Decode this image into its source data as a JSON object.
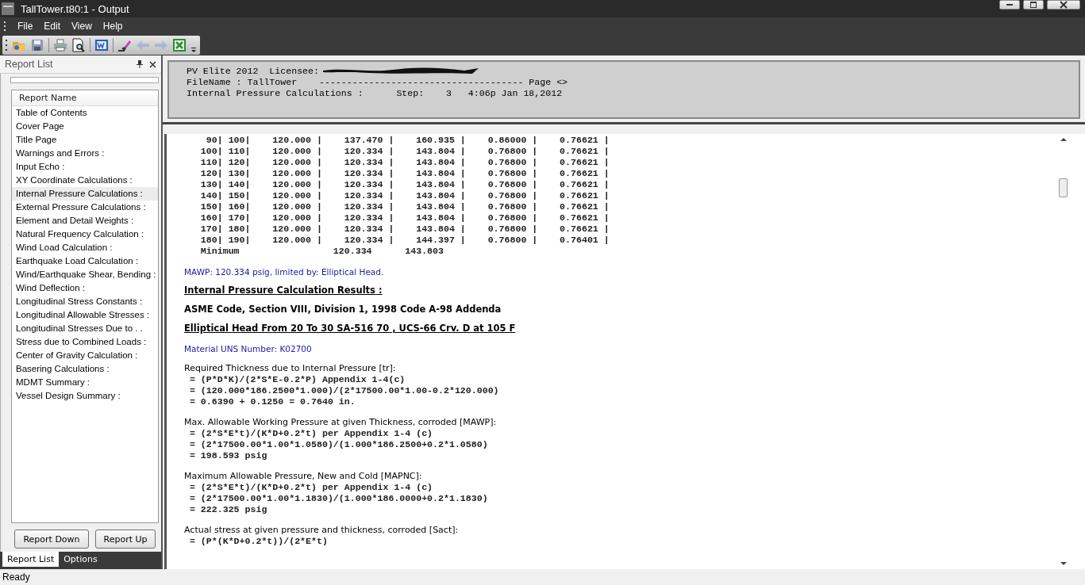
{
  "window": {
    "title": "TallTower.t80:1 - Output"
  },
  "menu": [
    "File",
    "Edit",
    "View",
    "Help"
  ],
  "toolbar": [
    {
      "kind": "open",
      "disabled": false
    },
    {
      "kind": "save",
      "disabled": false
    },
    {
      "kind": "sep"
    },
    {
      "kind": "print",
      "disabled": false
    },
    {
      "kind": "preview",
      "disabled": false
    },
    {
      "kind": "sep"
    },
    {
      "kind": "word",
      "disabled": false
    },
    {
      "kind": "sep"
    },
    {
      "kind": "eraser",
      "disabled": false
    },
    {
      "kind": "back",
      "disabled": true
    },
    {
      "kind": "forward",
      "disabled": true
    },
    {
      "kind": "excel",
      "disabled": false
    }
  ],
  "report_list": {
    "title": "Report List",
    "column": "Report Name",
    "items": [
      {
        "label": "Table of Contents",
        "selected": false
      },
      {
        "label": "Cover Page",
        "selected": false
      },
      {
        "label": "Title Page",
        "selected": false
      },
      {
        "label": "Warnings and Errors :",
        "selected": false
      },
      {
        "label": "Input Echo :",
        "selected": false
      },
      {
        "label": "XY Coordinate Calculations :",
        "selected": false
      },
      {
        "label": "Internal Pressure Calculations :",
        "selected": true
      },
      {
        "label": "External Pressure Calculations :",
        "selected": false
      },
      {
        "label": "Element and Detail Weights :",
        "selected": false
      },
      {
        "label": "Natural Frequency Calculation :",
        "selected": false
      },
      {
        "label": "Wind Load Calculation :",
        "selected": false
      },
      {
        "label": "Earthquake Load Calculation :",
        "selected": false
      },
      {
        "label": "Wind/Earthquake Shear, Bending :",
        "selected": false
      },
      {
        "label": "Wind Deflection :",
        "selected": false
      },
      {
        "label": "Longitudinal Stress Constants :",
        "selected": false
      },
      {
        "label": "Longitudinal Allowable Stresses :",
        "selected": false
      },
      {
        "label": "Longitudinal Stresses Due to . .",
        "selected": false
      },
      {
        "label": "Stress due to Combined Loads :",
        "selected": false
      },
      {
        "label": "Center of Gravity Calculation :",
        "selected": false
      },
      {
        "label": "Basering Calculations :",
        "selected": false
      },
      {
        "label": "MDMT Summary :",
        "selected": false
      },
      {
        "label": "Vessel Design Summary :",
        "selected": false
      }
    ],
    "buttons": [
      "Report Down",
      "Report Up"
    ]
  },
  "panel_tabs": [
    {
      "label": "Report List",
      "selected": true
    },
    {
      "label": "Options",
      "selected": false
    }
  ],
  "header": {
    "lines": [
      {
        "text": "PV Elite 2012  Licensee: ",
        "redacted": true
      },
      {
        "text": "FileName : TallTower    ------------------------------------- Page <>",
        "redacted": false
      },
      {
        "text": "Internal Pressure Calculations :      Step:    3   4:06p Jan 18,2012",
        "redacted": false
      }
    ]
  },
  "report": [
    {
      "kind": "mono",
      "text": "    90| 100|    120.000 |    137.470 |    160.935 |    0.86000 |    0.76621 |"
    },
    {
      "kind": "mono",
      "text": "   100| 110|    120.000 |    120.334 |    143.804 |    0.76800 |    0.76621 |"
    },
    {
      "kind": "mono",
      "text": "   110| 120|    120.000 |    120.334 |    143.804 |    0.76800 |    0.76621 |"
    },
    {
      "kind": "mono",
      "text": "   120| 130|    120.000 |    120.334 |    143.804 |    0.76800 |    0.76621 |"
    },
    {
      "kind": "mono",
      "text": "   130| 140|    120.000 |    120.334 |    143.804 |    0.76800 |    0.76621 |"
    },
    {
      "kind": "mono",
      "text": "   140| 150|    120.000 |    120.334 |    143.804 |    0.76800 |    0.76621 |"
    },
    {
      "kind": "mono",
      "text": "   150| 160|    120.000 |    120.334 |    143.804 |    0.76800 |    0.76621 |"
    },
    {
      "kind": "mono",
      "text": "   160| 170|    120.000 |    120.334 |    143.804 |    0.76800 |    0.76621 |"
    },
    {
      "kind": "mono",
      "text": "   170| 180|    120.000 |    120.334 |    143.804 |    0.76800 |    0.76621 |"
    },
    {
      "kind": "mono",
      "text": "   180| 190|    120.000 |    120.334 |    144.397 |    0.76800 |    0.76401 |"
    },
    {
      "kind": "mono",
      "text": "   Minimum                 120.334      143.803"
    },
    {
      "kind": "note",
      "text": "MAWP: 120.334 psig, limited by: Elliptical Head."
    },
    {
      "kind": "heading",
      "text": "Internal Pressure Calculation Results :"
    },
    {
      "kind": "bold",
      "text": "ASME Code, Section VIII, Division 1, 1998 Code A-98 Addenda"
    },
    {
      "kind": "heading",
      "text": "Elliptical Head From 20 To 30 SA-516 70 , UCS-66 Crv. D at 105 F"
    },
    {
      "kind": "note",
      "text": "Material UNS Number:    K02700"
    },
    {
      "kind": "label",
      "text": "Required Thickness due to Internal Pressure [tr]:"
    },
    {
      "kind": "mono",
      "text": " = (P*D*K)/(2*S*E-0.2*P) Appendix 1-4(c)"
    },
    {
      "kind": "mono",
      "text": " = (120.000*186.2500*1.000)/(2*17500.00*1.00-0.2*120.000)"
    },
    {
      "kind": "mono",
      "text": " = 0.6390 + 0.1250 = 0.7640 in."
    },
    {
      "kind": "label",
      "text": "Max. Allowable Working Pressure at given Thickness, corroded [MAWP]:"
    },
    {
      "kind": "mono",
      "text": " = (2*S*E*t)/(K*D+0.2*t) per Appendix 1-4 (c)"
    },
    {
      "kind": "mono",
      "text": " = (2*17500.00*1.00*1.0580)/(1.000*186.2500+0.2*1.0580)"
    },
    {
      "kind": "mono",
      "text": " = 198.593 psig"
    },
    {
      "kind": "label",
      "text": "Maximum Allowable Pressure, New and Cold [MAPNC]:"
    },
    {
      "kind": "mono",
      "text": " = (2*S*E*t)/(K*D+0.2*t) per Appendix 1-4 (c)"
    },
    {
      "kind": "mono",
      "text": " = (2*17500.00*1.00*1.1830)/(1.000*186.0000+0.2*1.1830)"
    },
    {
      "kind": "mono",
      "text": " = 222.325 psig"
    },
    {
      "kind": "label",
      "text": "Actual stress at given pressure and thickness, corroded [Sact]:"
    },
    {
      "kind": "mono",
      "text": " = (P*(K*D+0.2*t))/(2*E*t)"
    }
  ],
  "status_bar": "Ready"
}
